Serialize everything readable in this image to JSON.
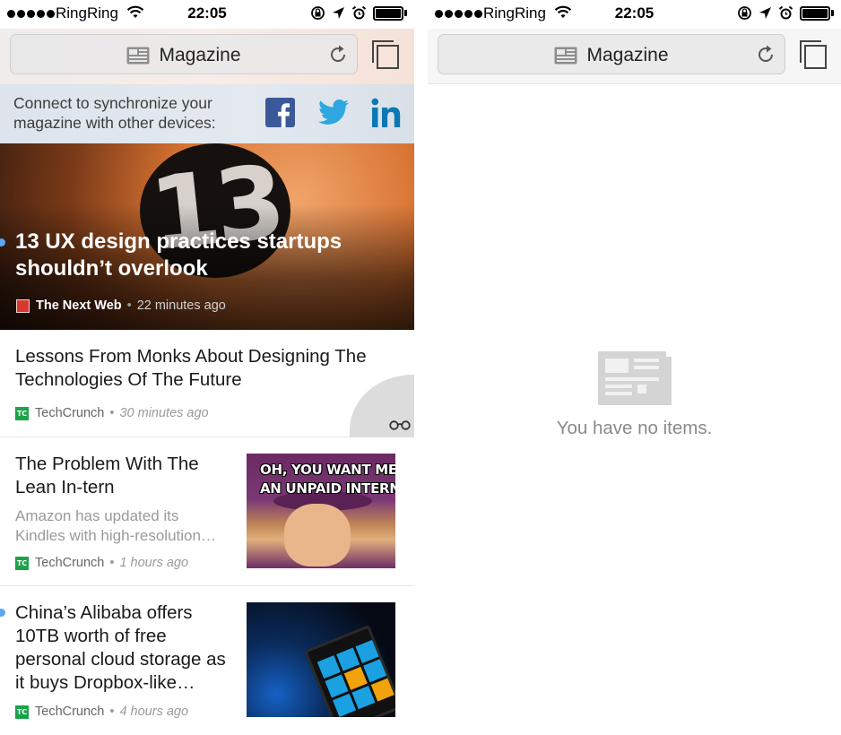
{
  "status_bar": {
    "carrier": "RingRing",
    "time": "22:05"
  },
  "nav": {
    "title": "Magazine"
  },
  "connect": {
    "text": "Connect to synchronize your magazine with other devices:",
    "networks": [
      "facebook-icon",
      "twitter-icon",
      "linkedin-icon"
    ]
  },
  "hero": {
    "image_text": "13",
    "title": "13 UX design practices startups shouldn’t overlook",
    "source": "The Next Web",
    "separator": "•",
    "time": "22 minutes ago",
    "unread": true
  },
  "articles": [
    {
      "title": "Lessons From Monks About Designing The Technologies Of The Future",
      "source": "TechCrunch",
      "time": "30 minutes ago"
    },
    {
      "title": "The Problem With The Lean In-tern",
      "description": "Amazon has updated its Kindles with high-resolution…",
      "source": "TechCrunch",
      "time": "1 hours ago",
      "thumb_text_1": "OH, YOU WANT ME TO TAK",
      "thumb_text_2": "AN UNPAID INTERNSHIP"
    },
    {
      "title": "China’s Alibaba offers 10TB worth of free personal cloud storage as it buys Dropbox-like…",
      "source": "TechCrunch",
      "time": "4 hours ago",
      "unread": true
    }
  ],
  "source_badge": "TC",
  "empty_state": {
    "message": "You have no items."
  },
  "colors": {
    "unread_dot": "#5aa7f0",
    "facebook": "#3b5998",
    "twitter": "#2ea7e0",
    "linkedin": "#0b78b3",
    "techcrunch": "#1ba34a"
  }
}
